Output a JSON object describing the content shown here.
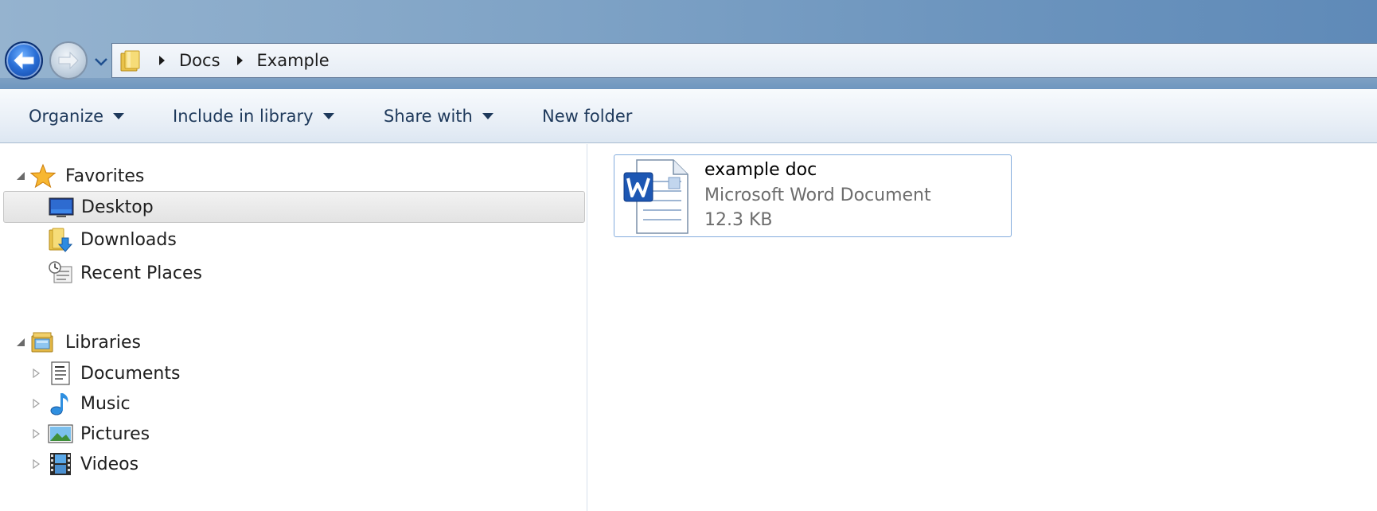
{
  "address": {
    "crumbs": [
      "Docs",
      "Example"
    ]
  },
  "toolbar": {
    "organize_label": "Organize",
    "include_label": "Include in library",
    "share_label": "Share with",
    "new_folder_label": "New folder"
  },
  "nav_tree": {
    "favorites": {
      "label": "Favorites",
      "items": [
        {
          "label": "Desktop",
          "icon": "desktop-icon",
          "selected": true
        },
        {
          "label": "Downloads",
          "icon": "downloads-folder-icon"
        },
        {
          "label": "Recent Places",
          "icon": "recent-places-icon"
        }
      ]
    },
    "libraries": {
      "label": "Libraries",
      "items": [
        {
          "label": "Documents",
          "icon": "documents-library-icon"
        },
        {
          "label": "Music",
          "icon": "music-library-icon"
        },
        {
          "label": "Pictures",
          "icon": "pictures-library-icon"
        },
        {
          "label": "Videos",
          "icon": "videos-library-icon"
        }
      ]
    }
  },
  "files": [
    {
      "name": "example doc",
      "type": "Microsoft Word Document",
      "size": "12.3 KB",
      "icon": "word-document-icon"
    }
  ],
  "colors": {
    "selection_border": "#84acdd",
    "toolbar_text": "#1e395b",
    "secondary_text": "#6d6d6d"
  }
}
